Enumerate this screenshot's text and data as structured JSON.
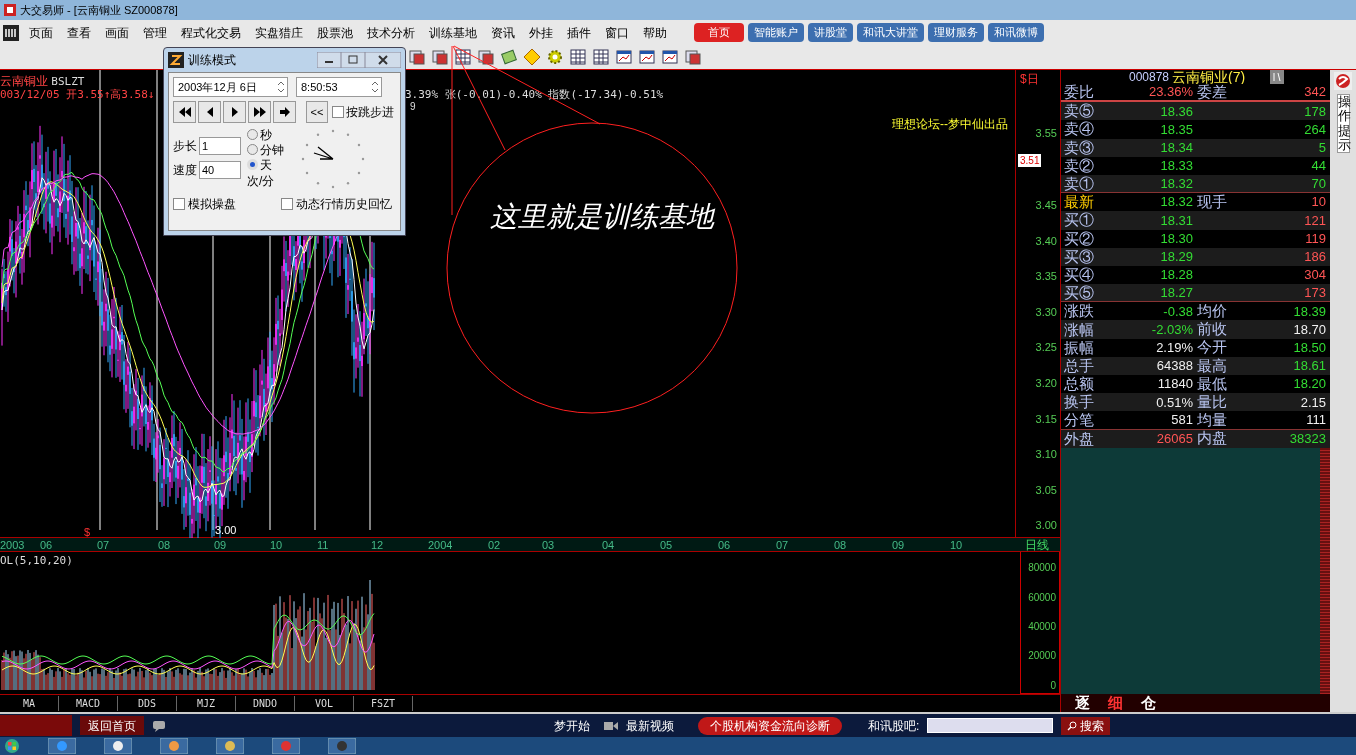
{
  "window": {
    "title": "大交易师 - [云南铜业 SZ000878]"
  },
  "menu": [
    "页面",
    "查看",
    "画面",
    "管理",
    "程式化交易",
    "实盘猎庄",
    "股票池",
    "技术分析",
    "训练基地",
    "资讯",
    "外挂",
    "插件",
    "窗口",
    "帮助"
  ],
  "top_links": [
    {
      "label": "首页",
      "selected": true
    },
    {
      "label": "智能账户",
      "selected": false
    },
    {
      "label": "讲股堂",
      "selected": false
    },
    {
      "label": "和讯大讲堂",
      "selected": false
    },
    {
      "label": "理财服务",
      "selected": false
    },
    {
      "label": "和讯微博",
      "selected": false
    }
  ],
  "chart": {
    "stock": "云南铜业",
    "indicator": "BSLZT",
    "info_left": "003/12/05 开3.55↑高3.58↓",
    "info_right": "3.39% 张(-0.01)-0.40% 指数(-17.34)-0.51%",
    "info_extra": "9",
    "credit": "理想论坛--梦中仙出品",
    "low_label": "3.00",
    "mark": "$",
    "corner_mark": "$日",
    "current_price": "3.51",
    "price_ticks": [
      "3.55",
      "3.45",
      "3.40",
      "3.35",
      "3.30",
      "3.25",
      "3.20",
      "3.15",
      "3.10",
      "3.05",
      "3.00"
    ],
    "dates": [
      "2003",
      "06",
      "07",
      "08",
      "09",
      "10",
      "11",
      "12",
      "2004",
      "02",
      "03",
      "04",
      "05",
      "06",
      "07",
      "08",
      "09",
      "10"
    ],
    "period": "日线",
    "volume_title": "OL(5,10,20)",
    "volume_ticks": [
      "80000",
      "60000",
      "40000",
      "20000",
      "0"
    ],
    "indicator_tabs": [
      "MA",
      "MACD",
      "DDS",
      "MJZ",
      "DNDO",
      "VOL",
      "FSZT"
    ]
  },
  "annotation": "这里就是训练基地",
  "dialog": {
    "title": "训练模式",
    "date": "2003年12月 6日",
    "time": "8:50:53",
    "back": "<<",
    "step_by_k": {
      "label": "按跳步进",
      "checked": false
    },
    "step_label": "步长",
    "step": "1",
    "speed_label": "速度",
    "speed": "40",
    "speed_unit": "次/分",
    "units": [
      {
        "label": "秒",
        "selected": false
      },
      {
        "label": "分钟",
        "selected": false
      },
      {
        "label": "天",
        "selected": true
      }
    ],
    "options": [
      {
        "label": "模拟操盘",
        "checked": false
      },
      {
        "label": "动态行情历史回忆",
        "checked": false
      }
    ]
  },
  "quote": {
    "code": "000878",
    "name": "云南铜业(7)",
    "rows": [
      {
        "label": "委比",
        "value": {
          "text": "23.36%",
          "color": "#ff5555"
        },
        "label2": "委差",
        "value2": {
          "text": "342",
          "color": "#ff5555"
        },
        "highlight": false
      },
      {
        "label": "卖⑤",
        "value": {
          "text": "18.36",
          "color": "#33dd33"
        },
        "value2": {
          "text": "178",
          "color": "#33dd33"
        },
        "highlight": false
      },
      {
        "label": "卖④",
        "value": {
          "text": "18.35",
          "color": "#33dd33"
        },
        "value2": {
          "text": "264",
          "color": "#33dd33"
        },
        "highlight": false
      },
      {
        "label": "卖③",
        "value": {
          "text": "18.34",
          "color": "#33dd33"
        },
        "value2": {
          "text": "5",
          "color": "#33dd33"
        },
        "highlight": false
      },
      {
        "label": "卖②",
        "value": {
          "text": "18.33",
          "color": "#33dd33"
        },
        "value2": {
          "text": "44",
          "color": "#33dd33"
        },
        "highlight": false
      },
      {
        "label": "卖①",
        "value": {
          "text": "18.32",
          "color": "#33dd33"
        },
        "value2": {
          "text": "70",
          "color": "#33dd33"
        },
        "highlight": false
      },
      {
        "label": "最新",
        "value": {
          "text": "18.32",
          "color": "#33dd33"
        },
        "label2": "现手",
        "value2": {
          "text": "10",
          "color": "#ff5555"
        },
        "highlight": true
      },
      {
        "label": "买①",
        "value": {
          "text": "18.31",
          "color": "#33dd33"
        },
        "value2": {
          "text": "121",
          "color": "#ff5555"
        },
        "highlight": false
      },
      {
        "label": "买②",
        "value": {
          "text": "18.30",
          "color": "#33dd33"
        },
        "value2": {
          "text": "119",
          "color": "#ff5555"
        },
        "highlight": false
      },
      {
        "label": "买③",
        "value": {
          "text": "18.29",
          "color": "#33dd33"
        },
        "value2": {
          "text": "186",
          "color": "#ff5555"
        },
        "highlight": false
      },
      {
        "label": "买④",
        "value": {
          "text": "18.28",
          "color": "#33dd33"
        },
        "value2": {
          "text": "304",
          "color": "#ff5555"
        },
        "highlight": false
      },
      {
        "label": "买⑤",
        "value": {
          "text": "18.27",
          "color": "#33dd33"
        },
        "value2": {
          "text": "173",
          "color": "#ff5555"
        },
        "highlight": false
      },
      {
        "label": "涨跌",
        "value": {
          "text": "-0.38",
          "color": "#33dd33"
        },
        "label2": "均价",
        "value2": {
          "text": "18.39",
          "color": "#33dd33"
        },
        "highlight": false
      },
      {
        "label": "涨幅",
        "value": {
          "text": "-2.03%",
          "color": "#33dd33"
        },
        "label2": "前收",
        "value2": {
          "text": "18.70",
          "color": "#f0f0f0"
        },
        "highlight": false
      },
      {
        "label": "振幅",
        "value": {
          "text": "2.19%",
          "color": "#f0f0f0"
        },
        "label2": "今开",
        "value2": {
          "text": "18.50",
          "color": "#33dd33"
        },
        "highlight": false
      },
      {
        "label": "总手",
        "value": {
          "text": "64388",
          "color": "#f0f0f0"
        },
        "label2": "最高",
        "value2": {
          "text": "18.61",
          "color": "#33dd33"
        },
        "highlight": false
      },
      {
        "label": "总额",
        "value": {
          "text": "11840",
          "color": "#f0f0f0"
        },
        "label2": "最低",
        "value2": {
          "text": "18.20",
          "color": "#33dd33"
        },
        "highlight": false
      },
      {
        "label": "换手",
        "value": {
          "text": "0.51%",
          "color": "#f0f0f0"
        },
        "label2": "量比",
        "value2": {
          "text": "2.15",
          "color": "#f0f0f0"
        },
        "highlight": false
      },
      {
        "label": "分笔",
        "value": {
          "text": "581",
          "color": "#f0f0f0"
        },
        "label2": "均量",
        "value2": {
          "text": "111",
          "color": "#f0f0f0"
        },
        "highlight": false
      },
      {
        "label": "外盘",
        "value": {
          "text": "26065",
          "color": "#ff5555"
        },
        "label2": "内盘",
        "value2": {
          "text": "38323",
          "color": "#33dd33"
        },
        "highlight": false
      }
    ],
    "tabs": [
      {
        "label": "逐",
        "selected": false
      },
      {
        "label": "细",
        "selected": true
      },
      {
        "label": "仓",
        "selected": false
      }
    ]
  },
  "side_panel": "操作提示",
  "bottom_bar": {
    "home": "返回首页",
    "dream": "梦开始",
    "video": "最新视频",
    "promo": "个股机构资金流向诊断",
    "forum_label": "和讯股吧:",
    "search": "搜索"
  }
}
